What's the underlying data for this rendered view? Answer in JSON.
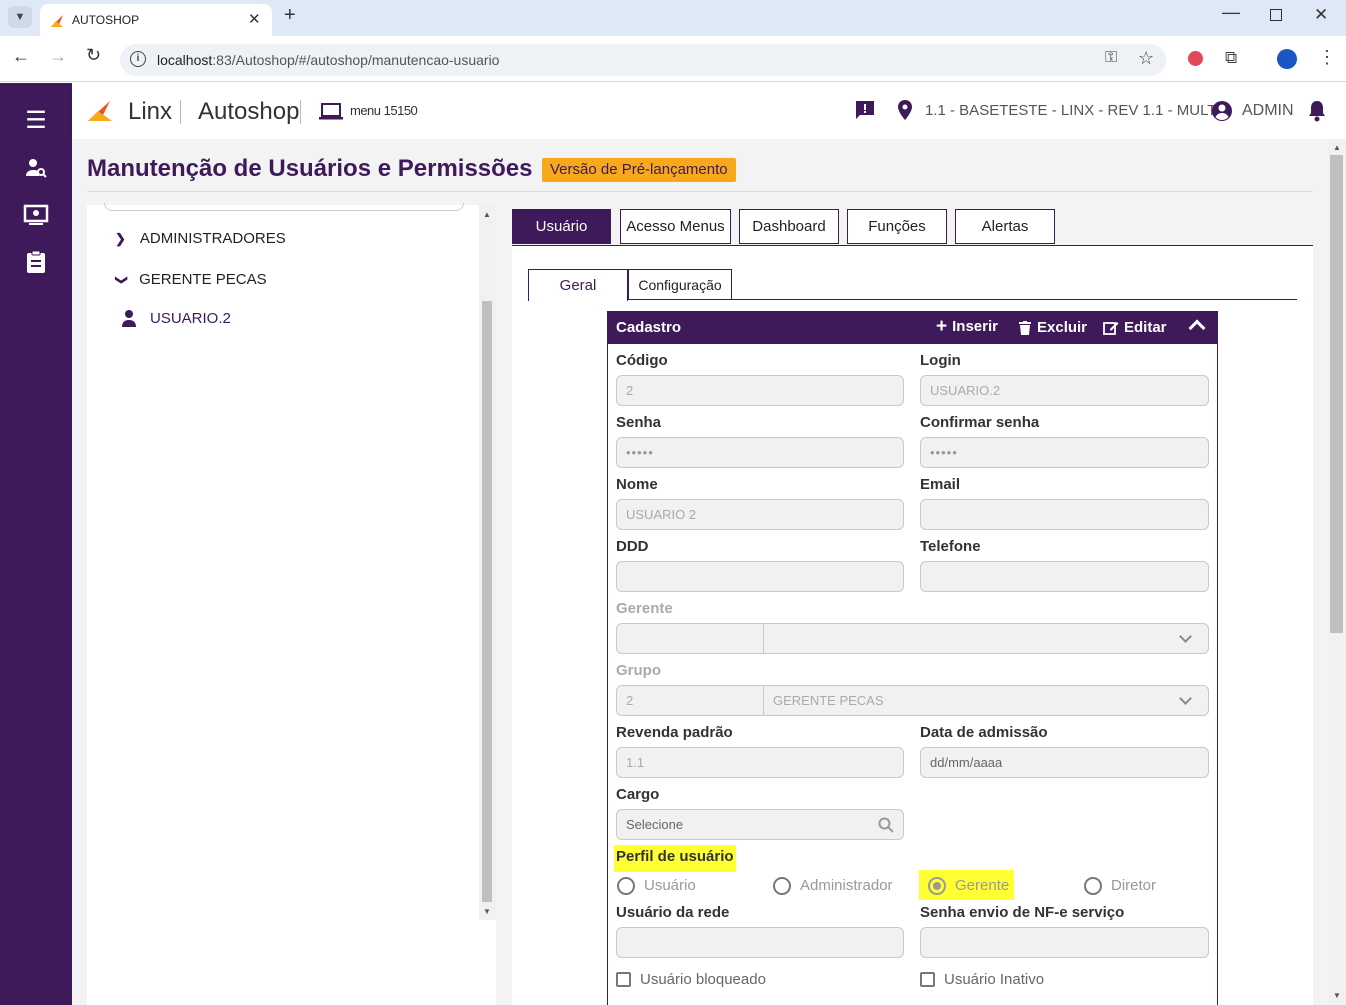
{
  "browser": {
    "tab_title": "AUTOSHOP",
    "url_host": "localhost",
    "url_rest": ":83/Autoshop/#/autoshop/manutencao-usuario"
  },
  "header": {
    "brand": "Linx",
    "product": "Autoshop",
    "menu_label": "menu 15150",
    "company": "1.1 - BASETESTE - LINX - REV 1.1 - MULT",
    "user": "ADMIN"
  },
  "page": {
    "title": "Manutenção de Usuários e Permissões",
    "badge": "Versão de Pré-lançamento"
  },
  "tree": {
    "items": [
      {
        "label": "ADMINISTRADORES"
      },
      {
        "label": "GERENTE PECAS"
      },
      {
        "label": "USUARIO.2"
      }
    ]
  },
  "tabs": [
    "Usuário",
    "Acesso Menus",
    "Dashboard",
    "Funções",
    "Alertas"
  ],
  "subtabs": [
    "Geral",
    "Configuração"
  ],
  "card": {
    "title": "Cadastro",
    "insert": "Inserir",
    "delete": "Excluir",
    "edit": "Editar"
  },
  "form": {
    "codigo_label": "Código",
    "codigo_value": "2",
    "login_label": "Login",
    "login_value": "USUARIO.2",
    "senha_label": "Senha",
    "senha_value": "•••••",
    "confirmar_label": "Confirmar senha",
    "confirmar_value": "•••••",
    "nome_label": "Nome",
    "nome_value": "USUARIO 2",
    "email_label": "Email",
    "ddd_label": "DDD",
    "telefone_label": "Telefone",
    "gerente_label": "Gerente",
    "grupo_label": "Grupo",
    "grupo_code": "2",
    "grupo_name": "GERENTE PECAS",
    "revenda_label": "Revenda padrão",
    "revenda_value": "1.1",
    "admissao_label": "Data de admissão",
    "admissao_placeholder": "dd/mm/aaaa",
    "cargo_label": "Cargo",
    "cargo_placeholder": "Selecione",
    "perfil_label": "Perfil de usuário",
    "perfil_options": [
      "Usuário",
      "Administrador",
      "Gerente",
      "Diretor"
    ],
    "perfil_selected": "Gerente",
    "rede_label": "Usuário da rede",
    "nfe_label": "Senha envio de NF-e serviço",
    "bloqueado_label": "Usuário bloqueado",
    "inativo_label": "Usuário Inativo"
  }
}
